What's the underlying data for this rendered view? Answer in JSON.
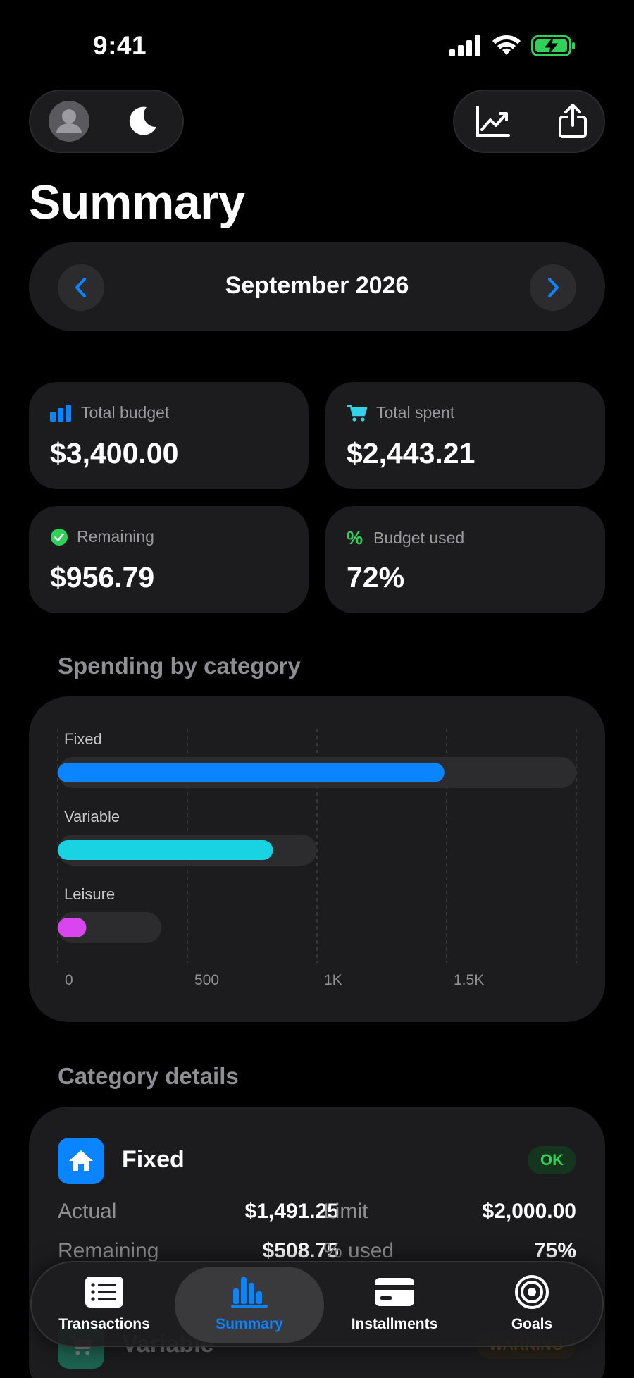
{
  "status_bar": {
    "time": "9:41"
  },
  "header": {
    "title": "Summary",
    "profile_icon": "person-icon",
    "theme_icon": "moon-icon",
    "chart_icon": "trend-chart-icon",
    "share_icon": "share-icon"
  },
  "month_selector": {
    "label": "September 2026"
  },
  "stats": [
    {
      "label": "Total budget",
      "value": "$3,400.00",
      "icon": "bar-chart-icon",
      "color": "#0a84ff"
    },
    {
      "label": "Total spent",
      "value": "$2,443.21",
      "icon": "cart-icon",
      "color": "#32d3e6"
    },
    {
      "label": "Remaining",
      "value": "$956.79",
      "icon": "checkmark-circle-icon",
      "color": "#30d158"
    },
    {
      "label": "Budget used",
      "value": "72%",
      "icon": "percent-icon",
      "color": "#30d158"
    }
  ],
  "spending_section": {
    "title": "Spending by category"
  },
  "chart_data": {
    "type": "bar",
    "orientation": "horizontal",
    "categories": [
      "Fixed",
      "Variable",
      "Leisure"
    ],
    "values": [
      1491.25,
      830,
      110
    ],
    "limits": [
      2000,
      1000,
      400
    ],
    "colors": [
      "#0a84ff",
      "#19d3e3",
      "#d946ef"
    ],
    "x_ticks": [
      "0",
      "500",
      "1K",
      "1.5K"
    ],
    "xlim": [
      0,
      2000
    ],
    "grid": true
  },
  "details_section": {
    "title": "Category details"
  },
  "category_details": [
    {
      "name": "Fixed",
      "icon": "house-icon",
      "status": "OK",
      "actual_label": "Actual",
      "actual": "$1,491.25",
      "limit_label": "Limit",
      "limit": "$2,000.00",
      "remaining_label": "Remaining",
      "remaining": "$508.75",
      "used_label": "% used",
      "used": "75%"
    },
    {
      "name": "Variable",
      "icon": "cart-icon",
      "status": "WARNING"
    }
  ],
  "tab_bar": {
    "tabs": [
      {
        "label": "Transactions",
        "icon": "list-icon"
      },
      {
        "label": "Summary",
        "icon": "bar-chart-icon",
        "active": true
      },
      {
        "label": "Installments",
        "icon": "credit-card-icon"
      },
      {
        "label": "Goals",
        "icon": "target-icon"
      }
    ]
  }
}
